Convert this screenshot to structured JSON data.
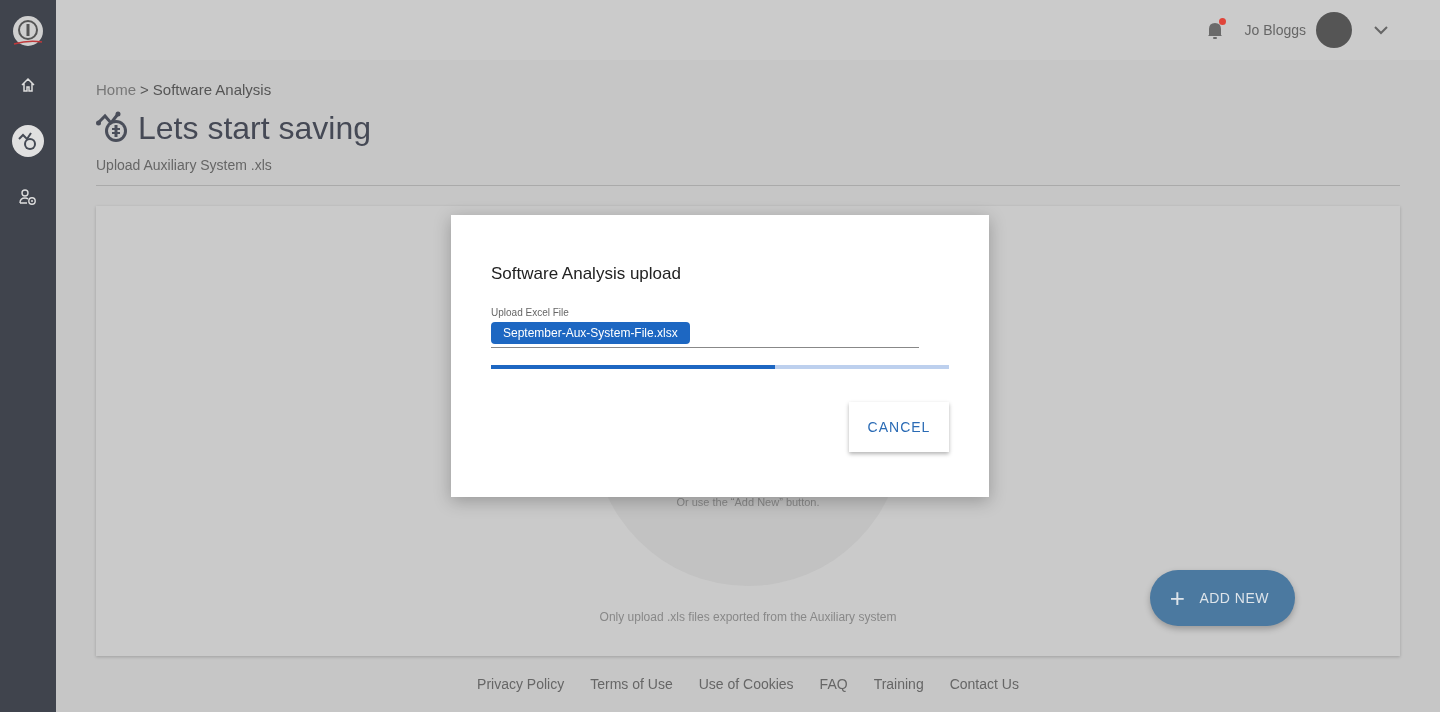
{
  "sidebar": {
    "items": [
      {
        "kind": "home",
        "selected": false
      },
      {
        "kind": "savings",
        "selected": true
      },
      {
        "kind": "user-settings",
        "selected": false
      }
    ]
  },
  "header": {
    "notification_unread": true,
    "user_name": "Jo Bloggs"
  },
  "breadcrumb": {
    "items": [
      "Home",
      "Software Analysis"
    ],
    "separator": ">"
  },
  "page": {
    "title": "Lets start saving",
    "subtitle": "Upload Auxiliary System .xls"
  },
  "card": {
    "hint": "Or use the “Add New” button.",
    "note": "Only upload .xls files exported from the Auxiliary system",
    "add_button": {
      "icon": "+",
      "label": "ADD NEW"
    }
  },
  "dialog": {
    "title": "Software Analysis upload",
    "field_label": "Upload Excel File",
    "file_name": "September-Aux-System-File.xlsx",
    "progress": {
      "level": 0.62
    },
    "buttons": [
      "CANCEL"
    ]
  },
  "footer": {
    "links": [
      "Privacy Policy",
      "Terms of Use",
      "Use of Cookies",
      "FAQ",
      "Training",
      "Contact Us"
    ]
  }
}
